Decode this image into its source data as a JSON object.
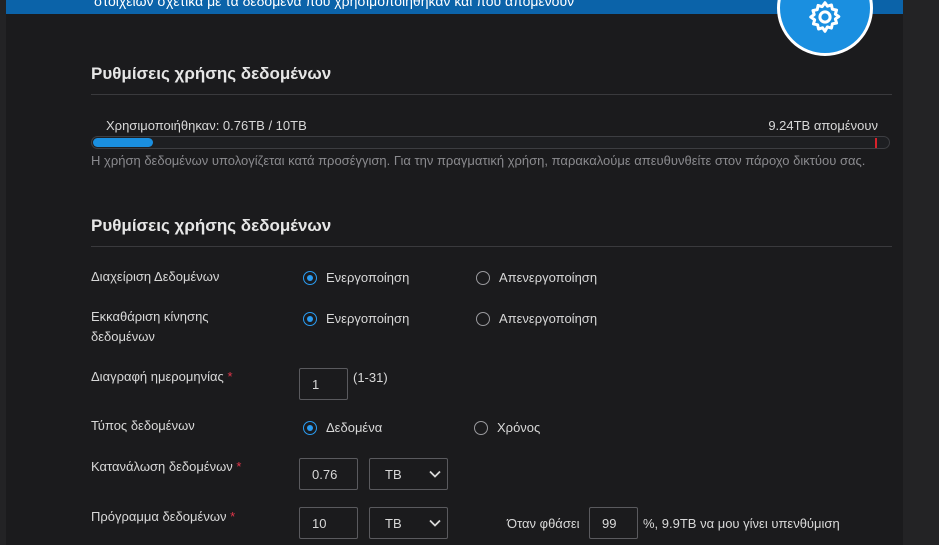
{
  "banner": {
    "text": "στοιχείων σχετικά με τα δεδομένα που χρησιμοποιήθηκαν και που απομένουν"
  },
  "usage_section": {
    "title": "Ρυθμίσεις χρήσης δεδομένων",
    "used_label": "Χρησιμοποιήθηκαν: 0.76TB / 10TB",
    "remaining_label": "9.24TB απομένουν",
    "used_fraction": 0.076,
    "note": "Η χρήση δεδομένων υπολογίζεται κατά προσέγγιση. Για την πραγματική χρήση, παρακαλούμε απευθυνθείτε στον πάροχο δικτύου σας."
  },
  "settings_section": {
    "title": "Ρυθμίσεις χρήσης δεδομένων",
    "data_management": {
      "label": "Διαχείριση Δεδομένων",
      "option_on": "Ενεργοποίηση",
      "option_off": "Απενεργοποίηση",
      "selected": "on"
    },
    "traffic_clear": {
      "label": "Εκκαθάριση κίνησης δεδομένων",
      "option_on": "Ενεργοποίηση",
      "option_off": "Απενεργοποίηση",
      "selected": "on"
    },
    "delete_date": {
      "label": "Διαγραφή ημερομηνίας",
      "required_mark": "*",
      "value": "1",
      "range_hint": "(1-31)"
    },
    "data_type": {
      "label": "Τύπος δεδομένων",
      "option_data": "Δεδομένα",
      "option_time": "Χρόνος",
      "selected": "data"
    },
    "consumption": {
      "label": "Κατανάλωση δεδομένων",
      "required_mark": "*",
      "value": "0.76",
      "unit": "TB"
    },
    "plan": {
      "label": "Πρόγραμμα δεδομένων",
      "required_mark": "*",
      "value": "10",
      "unit": "TB",
      "reminder_prefix": "Όταν φθάσει",
      "reminder_value": "99",
      "reminder_suffix": "%, 9.9TB να μου γίνει υπενθύμιση"
    }
  },
  "colors": {
    "accent": "#1a8fe0",
    "banner": "#0b63a9",
    "required": "#e2364a",
    "limit_marker": "#d8222b"
  }
}
